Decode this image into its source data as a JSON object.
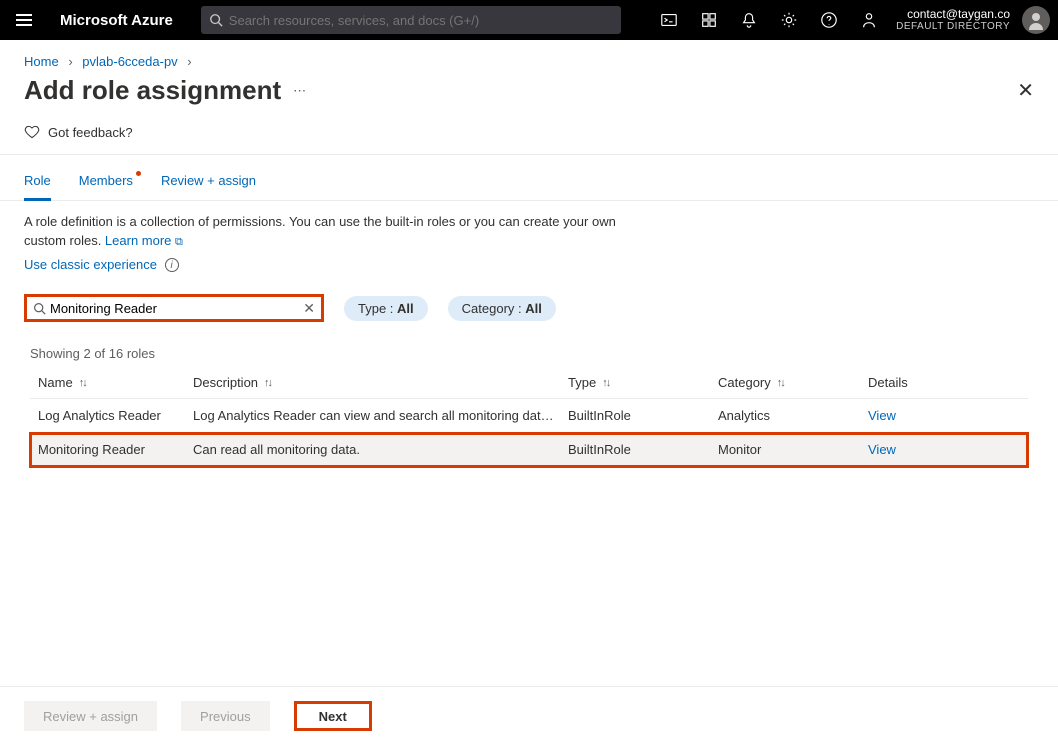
{
  "topbar": {
    "brand": "Microsoft Azure",
    "search_placeholder": "Search resources, services, and docs (G+/)",
    "account_email": "contact@taygan.co",
    "account_directory": "DEFAULT DIRECTORY"
  },
  "breadcrumb": {
    "home": "Home",
    "resource": "pvlab-6cceda-pv"
  },
  "page": {
    "title": "Add role assignment",
    "feedback": "Got feedback?",
    "close": "✕"
  },
  "tabs": {
    "role": "Role",
    "members": "Members",
    "review": "Review + assign"
  },
  "description": {
    "text": "A role definition is a collection of permissions. You can use the built-in roles or you can create your own custom roles. ",
    "learn_more": "Learn more",
    "classic": "Use classic experience"
  },
  "filters": {
    "search_value": "Monitoring Reader",
    "type_label": "Type : ",
    "type_value": "All",
    "category_label": "Category : ",
    "category_value": "All"
  },
  "table": {
    "count": "Showing 2 of 16 roles",
    "headers": {
      "name": "Name",
      "description": "Description",
      "type": "Type",
      "category": "Category",
      "details": "Details"
    },
    "rows": [
      {
        "name": "Log Analytics Reader",
        "description": "Log Analytics Reader can view and search all monitoring data ...",
        "type": "BuiltInRole",
        "category": "Analytics",
        "details": "View"
      },
      {
        "name": "Monitoring Reader",
        "description": "Can read all monitoring data.",
        "type": "BuiltInRole",
        "category": "Monitor",
        "details": "View"
      }
    ]
  },
  "footer": {
    "review": "Review + assign",
    "previous": "Previous",
    "next": "Next"
  }
}
